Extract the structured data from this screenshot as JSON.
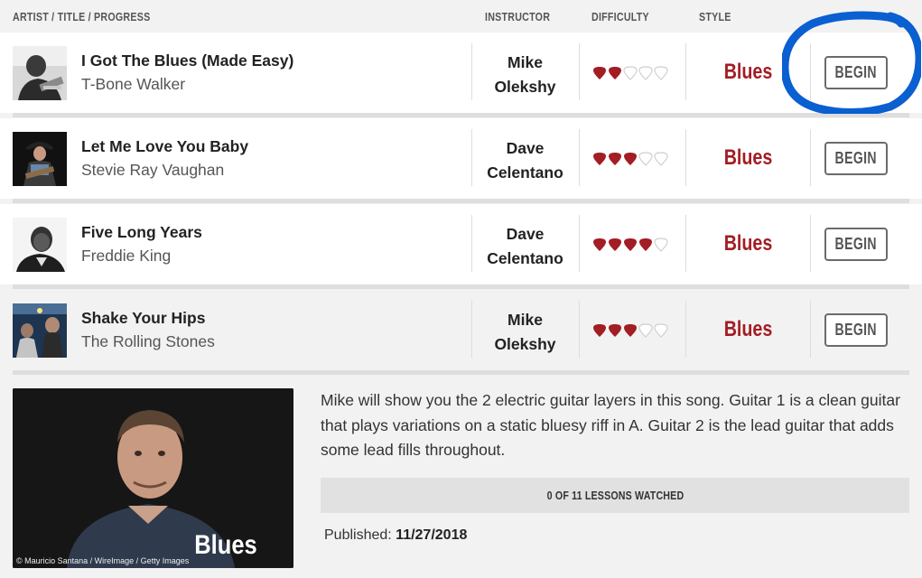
{
  "header": {
    "col_main": "ARTIST / TITLE / PROGRESS",
    "col_instructor": "INSTRUCTOR",
    "col_difficulty": "DIFFICULTY",
    "col_style": "STYLE"
  },
  "colors": {
    "pick_filled": "#a31d24",
    "pick_empty_stroke": "#cfcfcf",
    "style_text": "#a31d24",
    "highlight": "#0a5fd1"
  },
  "songs": [
    {
      "title": "I Got The Blues (Made Easy)",
      "artist": "T-Bone Walker",
      "instructor_first": "Mike",
      "instructor_last": "Olekshy",
      "difficulty": 2,
      "difficulty_max": 5,
      "style": "Blues",
      "button": "BEGIN",
      "highlighted": true
    },
    {
      "title": "Let Me Love You Baby",
      "artist": "Stevie Ray Vaughan",
      "instructor_first": "Dave",
      "instructor_last": "Celentano",
      "difficulty": 3,
      "difficulty_max": 5,
      "style": "Blues",
      "button": "BEGIN",
      "highlighted": false
    },
    {
      "title": "Five Long Years",
      "artist": "Freddie King",
      "instructor_first": "Dave",
      "instructor_last": "Celentano",
      "difficulty": 4,
      "difficulty_max": 5,
      "style": "Blues",
      "button": "BEGIN",
      "highlighted": false
    },
    {
      "title": "Shake Your Hips",
      "artist": "The Rolling Stones",
      "instructor_first": "Mike",
      "instructor_last": "Olekshy",
      "difficulty": 3,
      "difficulty_max": 5,
      "style": "Blues",
      "button": "BEGIN",
      "highlighted": false
    }
  ],
  "detail": {
    "description": "Mike will show you the 2 electric guitar layers in this song. Guitar 1 is a clean guitar that plays variations on a static bluesy riff in A. Guitar 2 is the lead guitar that adds some lead fills throughout.",
    "progress_text": "0 OF 11 LESSONS WATCHED",
    "published_label": "Published:",
    "published_date": "11/27/2018",
    "video_style": "Blues",
    "video_credit": "© Mauricio Santana / WireImage / Getty Images"
  }
}
